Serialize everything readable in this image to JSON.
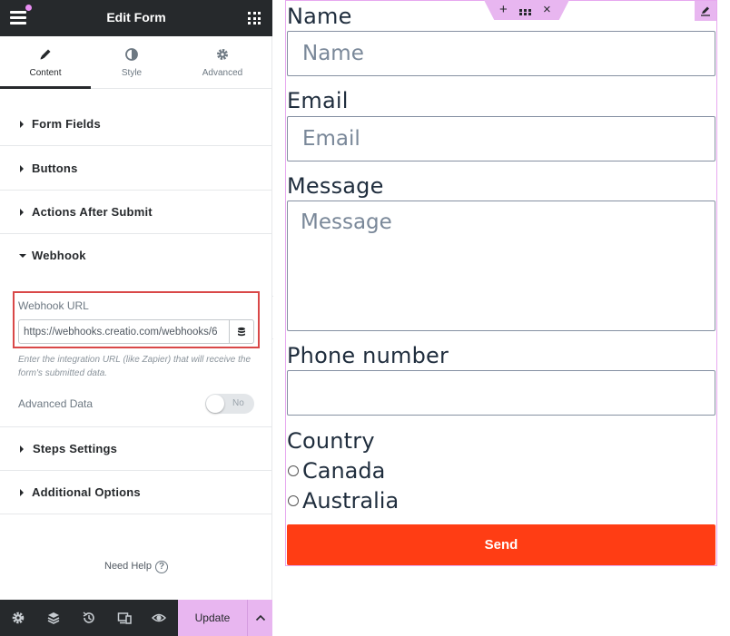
{
  "header": {
    "title": "Edit Form"
  },
  "tabs": [
    {
      "label": "Content",
      "icon": "pencil-icon",
      "active": true
    },
    {
      "label": "Style",
      "icon": "contrast-icon",
      "active": false
    },
    {
      "label": "Advanced",
      "icon": "gear-icon",
      "active": false
    }
  ],
  "sections": {
    "form_fields": "Form Fields",
    "buttons": "Buttons",
    "actions_after_submit": "Actions After Submit",
    "webhook": "Webhook",
    "steps_settings": "Steps Settings",
    "additional_options": "Additional Options"
  },
  "webhook": {
    "url_label": "Webhook URL",
    "url_value": "https://webhooks.creatio.com/webhooks/6",
    "help_text": "Enter the integration URL (like Zapier) that will receive the form's submitted data.",
    "advanced_data_label": "Advanced Data",
    "advanced_data_toggle": "No"
  },
  "footer": {
    "need_help": "Need Help",
    "update_label": "Update"
  },
  "colors": {
    "header_bg": "#26292c",
    "accent_pink": "#e8b6f0",
    "send_button": "#ff3d14",
    "highlight_border": "#d94848"
  },
  "form": {
    "name": {
      "label": "Name",
      "placeholder": "Name"
    },
    "email": {
      "label": "Email",
      "placeholder": "Email"
    },
    "message": {
      "label": "Message",
      "placeholder": "Message"
    },
    "phone": {
      "label": "Phone number",
      "placeholder": ""
    },
    "country": {
      "label": "Country",
      "options": [
        "Canada",
        "Australia"
      ]
    },
    "submit_label": "Send"
  }
}
